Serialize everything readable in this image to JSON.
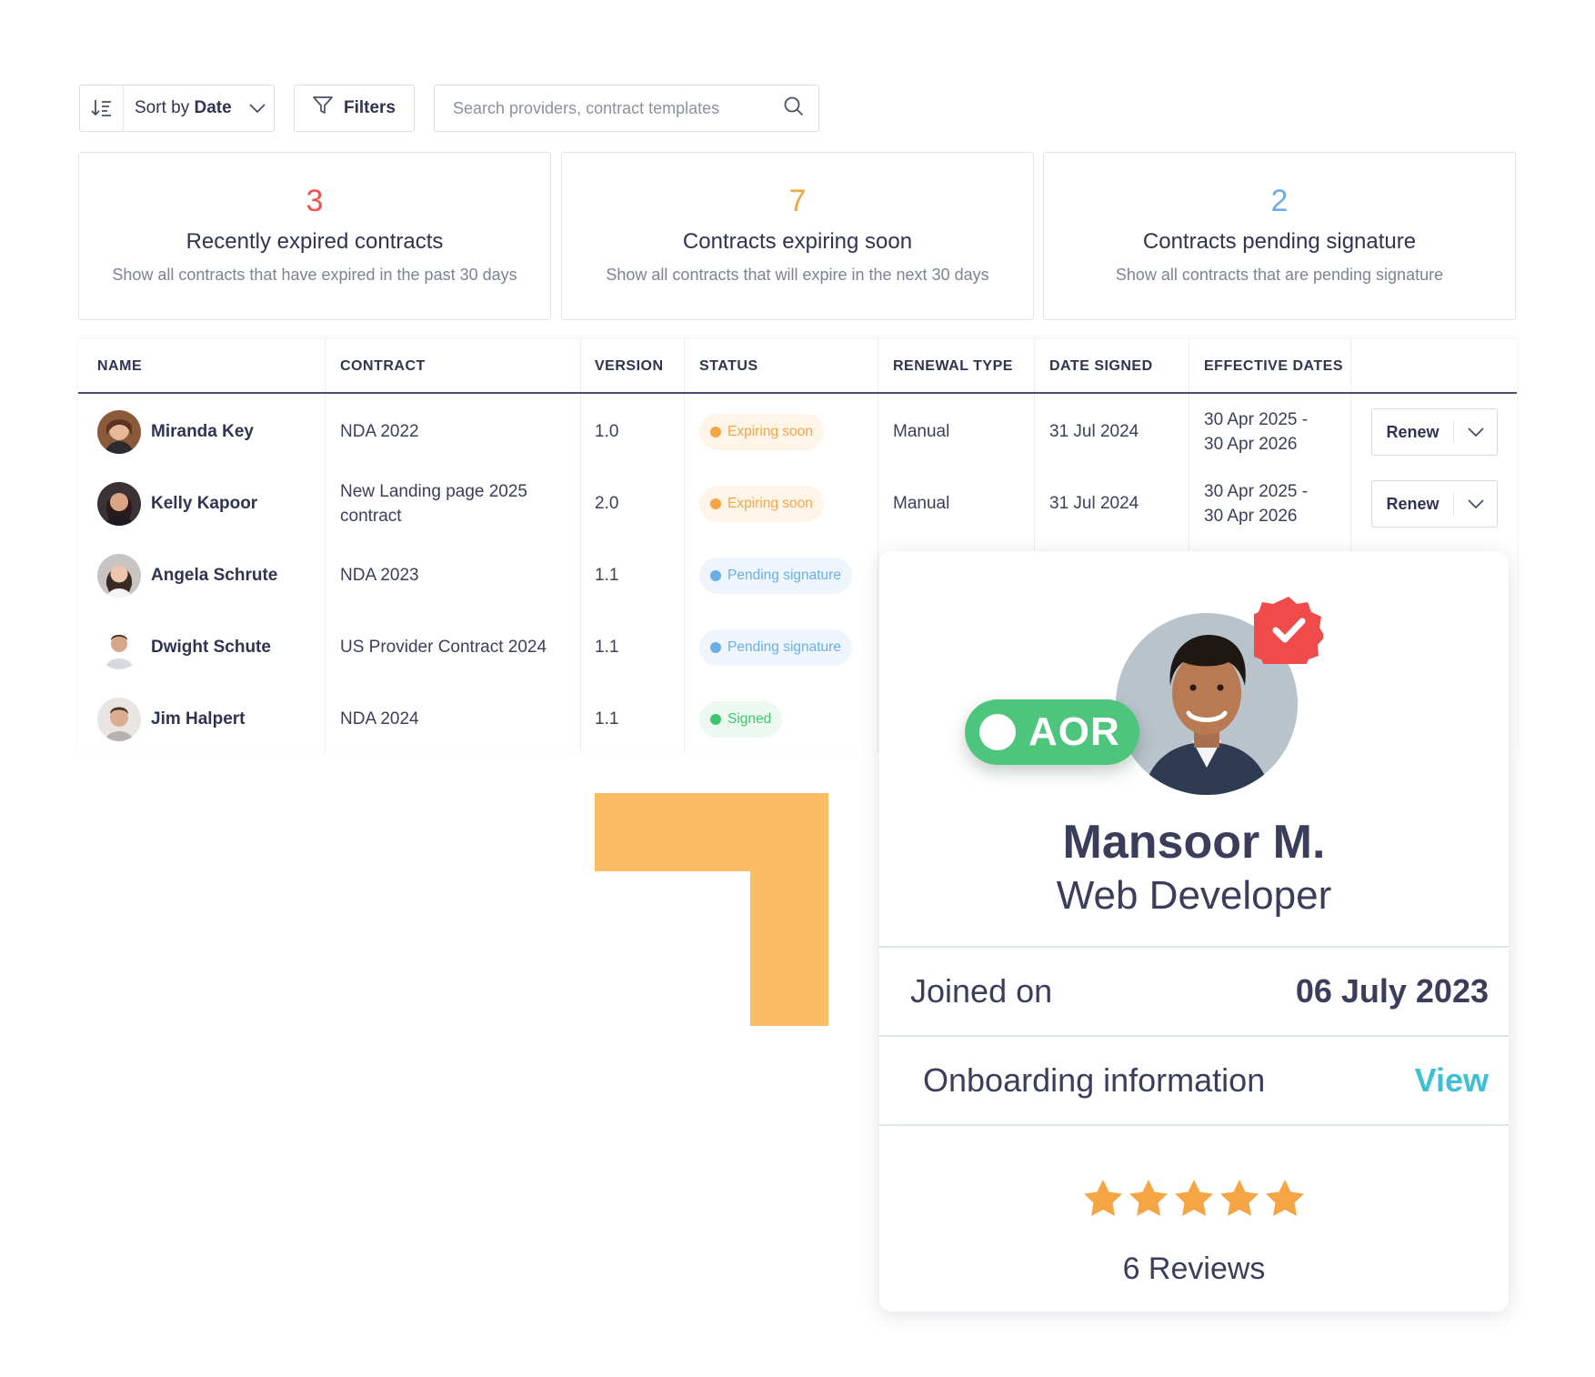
{
  "toolbar": {
    "sort_prefix": "Sort by",
    "sort_value": "Date",
    "filters_label": "Filters",
    "search_placeholder": "Search providers, contract templates"
  },
  "stats": [
    {
      "count": "3",
      "title": "Recently expired contracts",
      "description": "Show all contracts that have expired in the past 30 days",
      "color": "#f0524f"
    },
    {
      "count": "7",
      "title": "Contracts expiring soon",
      "description": "Show all contracts that will expire in the next 30 days",
      "color": "#f5a544"
    },
    {
      "count": "2",
      "title": "Contracts pending signature",
      "description": "Show all contracts that are pending signature",
      "color": "#6aaee8"
    }
  ],
  "table": {
    "headers": [
      "NAME",
      "CONTRACT",
      "VERSION",
      "STATUS",
      "RENEWAL TYPE",
      "DATE SIGNED",
      "EFFECTIVE DATES"
    ],
    "rows": [
      {
        "name": "Miranda Key",
        "contract": "NDA 2022",
        "version": "1.0",
        "status": "Expiring soon",
        "renewal": "Manual",
        "signed": "31 Jul 2024",
        "eff_start": "30 Apr 2025 -",
        "eff_end": "30 Apr 2026",
        "action": "Renew"
      },
      {
        "name": "Kelly Kapoor",
        "contract": "New Landing page 2025 contract",
        "version": "2.0",
        "status": "Expiring soon",
        "renewal": "Manual",
        "signed": "31 Jul 2024",
        "eff_start": "30 Apr 2025 -",
        "eff_end": "30 Apr 2026",
        "action": "Renew"
      },
      {
        "name": "Angela Schrute",
        "contract": "NDA 2023",
        "version": "1.1",
        "status": "Pending signature"
      },
      {
        "name": "Dwight Schute",
        "contract": "US Provider Contract 2024",
        "version": "1.1",
        "status": "Pending signature"
      },
      {
        "name": "Jim Halpert",
        "contract": "NDA 2024",
        "version": "1.1",
        "status": "Signed"
      }
    ]
  },
  "status_colors": {
    "expiring": {
      "bg": "#fff4e8",
      "dot": "#f5a544",
      "text": "#f5a544"
    },
    "pending": {
      "bg": "#eef5fd",
      "dot": "#6aaee8",
      "text": "#6aaee8"
    },
    "signed": {
      "bg": "#ecf9f0",
      "dot": "#3fc56e",
      "text": "#3fc56e"
    }
  },
  "profile": {
    "badge": "AOR",
    "name": "Mansoor M.",
    "role": "Web Developer",
    "joined_label": "Joined on",
    "joined_value": "06 July 2023",
    "onboarding_label": "Onboarding information",
    "onboarding_link": "View",
    "rating_stars": 5,
    "reviews": "6 Reviews"
  }
}
